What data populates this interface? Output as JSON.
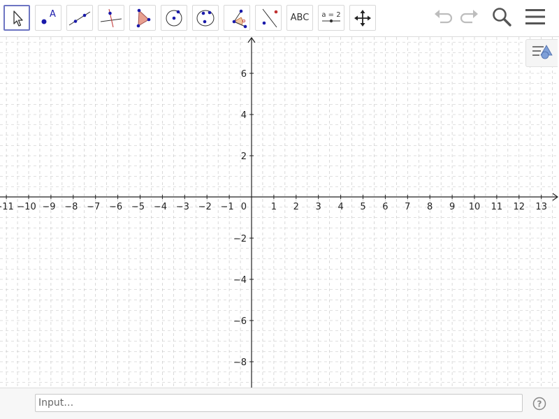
{
  "toolbar": {
    "tools": [
      {
        "id": "move",
        "icon": "arrow-pointer-icon",
        "active": true
      },
      {
        "id": "point",
        "icon": "point-icon",
        "label": "A"
      },
      {
        "id": "line",
        "icon": "line-through-two-points-icon"
      },
      {
        "id": "perpendicular",
        "icon": "perpendicular-line-icon"
      },
      {
        "id": "polygon",
        "icon": "polygon-icon"
      },
      {
        "id": "circle",
        "icon": "circle-center-point-icon"
      },
      {
        "id": "ellipse",
        "icon": "ellipse-icon"
      },
      {
        "id": "angle",
        "icon": "angle-icon"
      },
      {
        "id": "reflect",
        "icon": "reflect-about-line-icon"
      },
      {
        "id": "text",
        "icon": "text-icon",
        "label": "ABC"
      },
      {
        "id": "slider",
        "icon": "slider-icon",
        "label": "a = 2"
      },
      {
        "id": "move-graphics",
        "icon": "move-graphics-view-icon"
      }
    ],
    "undo_icon": "undo-icon",
    "redo_icon": "redo-icon",
    "search_icon": "search-icon",
    "menu_icon": "hamburger-menu-icon"
  },
  "graphics": {
    "x_ticks": [
      "−11",
      "−10",
      "−9",
      "−8",
      "−7",
      "−6",
      "−5",
      "−4",
      "−3",
      "−2",
      "−1",
      "1",
      "2",
      "3",
      "4",
      "5",
      "6",
      "7",
      "8",
      "9",
      "10",
      "11",
      "12",
      "13"
    ],
    "y_ticks": [
      "6",
      "4",
      "2",
      "−2",
      "−4",
      "−6",
      "−8"
    ],
    "origin_label": "0",
    "grid": true,
    "x_range": [
      -11,
      13
    ],
    "y_range": [
      -8,
      6
    ]
  },
  "input_bar": {
    "placeholder": "Input…",
    "help_icon": "help-icon"
  },
  "colors": {
    "accent": "#6d75c2",
    "point_blue": "#1a1aaa",
    "polygon_fill": "#e8a090",
    "grid": "#c0c0c0"
  }
}
